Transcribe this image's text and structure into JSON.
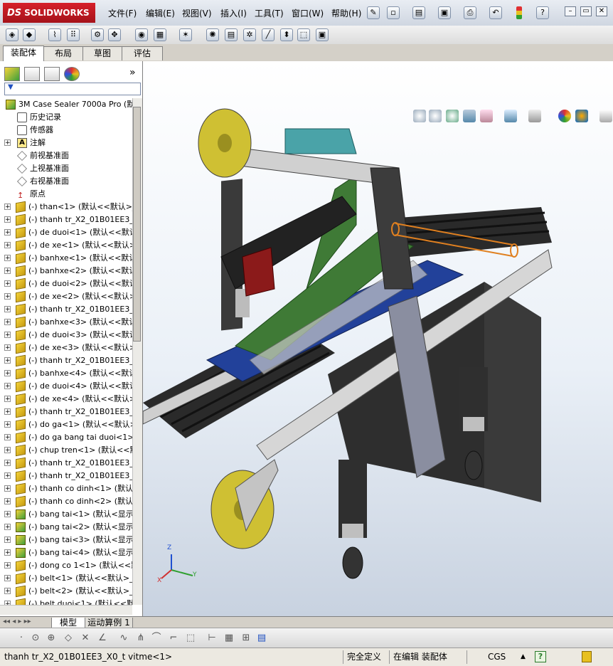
{
  "app": {
    "brand": "SOLIDWORKS",
    "brand_prefix": "DS"
  },
  "menu": [
    "文件(F)",
    "编辑(E)",
    "视图(V)",
    "插入(I)",
    "工具(T)",
    "窗口(W)",
    "帮助(H)"
  ],
  "command_tabs": [
    {
      "label": "装配体",
      "active": true
    },
    {
      "label": "布局",
      "active": false
    },
    {
      "label": "草图",
      "active": false
    },
    {
      "label": "评估",
      "active": false
    }
  ],
  "tree": {
    "root": "3M Case Sealer 7000a Pro  (默认<",
    "nodes": [
      {
        "label": "历史记录",
        "icon": "history-icon",
        "expand": false,
        "indent": 1
      },
      {
        "label": "传感器",
        "icon": "sensor-icon",
        "expand": false,
        "indent": 1
      },
      {
        "label": "注解",
        "icon": "annotation-icon",
        "expand": true,
        "indent": 1
      },
      {
        "label": "前视基准面",
        "icon": "plane-icon",
        "expand": false,
        "indent": 1
      },
      {
        "label": "上视基准面",
        "icon": "plane-icon",
        "expand": false,
        "indent": 1
      },
      {
        "label": "右视基准面",
        "icon": "plane-icon",
        "expand": false,
        "indent": 1
      },
      {
        "label": "原点",
        "icon": "origin-icon",
        "expand": false,
        "indent": 1
      },
      {
        "label": "(-) than<1> (默认<<默认>_",
        "icon": "part-icon",
        "expand": true
      },
      {
        "label": "(-) thanh tr_X2_01B01EE3_X(",
        "icon": "part-icon",
        "expand": true
      },
      {
        "label": "(-) de duoi<1> (默认<<默认",
        "icon": "part-icon",
        "expand": true
      },
      {
        "label": "(-) de xe<1> (默认<<默认>_",
        "icon": "part-icon",
        "expand": true
      },
      {
        "label": "(-) banhxe<1> (默认<<默认",
        "icon": "part-icon",
        "expand": true
      },
      {
        "label": "(-) banhxe<2> (默认<<默认",
        "icon": "part-icon",
        "expand": true
      },
      {
        "label": "(-) de duoi<2> (默认<<默认",
        "icon": "part-icon",
        "expand": true
      },
      {
        "label": "(-) de xe<2> (默认<<默认>_",
        "icon": "part-icon",
        "expand": true
      },
      {
        "label": "(-) thanh tr_X2_01B01EE3_X(",
        "icon": "part-icon",
        "expand": true
      },
      {
        "label": "(-) banhxe<3> (默认<<默认",
        "icon": "part-icon",
        "expand": true
      },
      {
        "label": "(-) de duoi<3> (默认<<默认",
        "icon": "part-icon",
        "expand": true
      },
      {
        "label": "(-) de xe<3> (默认<<默认>_",
        "icon": "part-icon",
        "expand": true
      },
      {
        "label": "(-) thanh tr_X2_01B01EE3_X(",
        "icon": "part-icon",
        "expand": true
      },
      {
        "label": "(-) banhxe<4> (默认<<默认",
        "icon": "part-icon",
        "expand": true
      },
      {
        "label": "(-) de duoi<4> (默认<<默认",
        "icon": "part-icon",
        "expand": true
      },
      {
        "label": "(-) de xe<4> (默认<<默认>_",
        "icon": "part-icon",
        "expand": true
      },
      {
        "label": "(-) thanh tr_X2_01B01EE3_X(",
        "icon": "part-icon",
        "expand": true
      },
      {
        "label": "(-) do ga<1> (默认<<默认>_",
        "icon": "part-icon",
        "expand": true
      },
      {
        "label": "(-) do ga bang tai duoi<1> (影",
        "icon": "part-icon",
        "expand": true
      },
      {
        "label": "(-) chup tren<1> (默认<<默",
        "icon": "part-icon",
        "expand": true
      },
      {
        "label": "(-) thanh tr_X2_01B01EE3_X(",
        "icon": "part-icon",
        "expand": true
      },
      {
        "label": "(-) thanh tr_X2_01B01EE3_X(",
        "icon": "part-icon",
        "expand": true
      },
      {
        "label": "(-) thanh co dinh<1> (默认<",
        "icon": "part-icon",
        "expand": true
      },
      {
        "label": "(-) thanh co dinh<2> (默认<",
        "icon": "part-icon",
        "expand": true
      },
      {
        "label": "(-) bang tai<1> (默认<显示",
        "icon": "assembly-icon",
        "expand": true
      },
      {
        "label": "(-) bang tai<2> (默认<显示",
        "icon": "assembly-icon",
        "expand": true
      },
      {
        "label": "(-) bang tai<3> (默认<显示",
        "icon": "assembly-icon",
        "expand": true
      },
      {
        "label": "(-) bang tai<4> (默认<显示",
        "icon": "assembly-icon",
        "expand": true
      },
      {
        "label": "(-) dong co 1<1> (默认<<默",
        "icon": "part-icon",
        "expand": true
      },
      {
        "label": "(-) belt<1> (默认<<默认>_",
        "icon": "part-icon",
        "expand": true
      },
      {
        "label": "(-) belt<2> (默认<<默认>_",
        "icon": "part-icon",
        "expand": true
      },
      {
        "label": "(-) belt duoi<1> (默认<<默",
        "icon": "part-icon",
        "expand": true
      }
    ]
  },
  "bottom_tabs": [
    {
      "label": "模型",
      "active": true
    },
    {
      "label": "运动算例 1",
      "active": false
    }
  ],
  "status": {
    "selection": "thanh tr_X2_01B01EE3_X0_t vitme<1>",
    "definition": "完全定义",
    "mode": "在编辑 装配体",
    "units": "CGS",
    "help": "?"
  },
  "triad": {
    "x": "X",
    "y": "Y",
    "z": "Z"
  },
  "colors": {
    "viewport_top": "#ffffff",
    "viewport_bottom": "#c8d2e0",
    "frame": "#3a3a3a",
    "conveyor_green": "#3f7a36",
    "conveyor_blue": "#22419a",
    "tape_yellow": "#cfc033",
    "motor_teal": "#4aa3a8",
    "belt_red": "#8b1a1a",
    "highlight_orange": "#e08020"
  }
}
